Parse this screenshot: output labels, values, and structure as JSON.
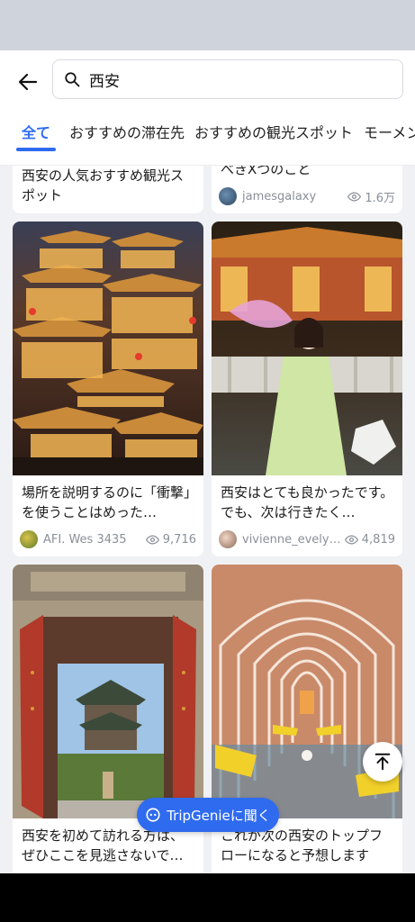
{
  "search": {
    "query": "西安"
  },
  "tabs": [
    {
      "label": "全て",
      "active": true
    },
    {
      "label": "おすすめの滞在先",
      "active": false
    },
    {
      "label": "おすすめの観光スポット",
      "active": false
    },
    {
      "label": "モーメン",
      "active": false
    }
  ],
  "cards": [
    {
      "title": "西安の人気おすすめ観光スポット",
      "author": "",
      "views": ""
    },
    {
      "title": "べきXつのこと",
      "author": "jamesgalaxy",
      "views": "1.6万"
    },
    {
      "title": "場所を説明するのに「衝撃」を使うことはめった…",
      "author": "AFI. Wes 3435",
      "views": "9,716"
    },
    {
      "title": "西安はとても良かったです。でも、次は行きたく…",
      "author": "vivienne_evelyn…",
      "views": "4,819"
    },
    {
      "title": "西安を初めて訪れる方は、ぜひここを見逃さないで…",
      "author": "",
      "views": ""
    },
    {
      "title": "これが次の西安のトップフローになると予想します",
      "author": "",
      "views": ""
    }
  ],
  "floating": {
    "tripgenie_label": "TripGenieに聞く"
  },
  "icons": {
    "back": "arrow-left-icon",
    "search": "search-icon",
    "views": "eye-icon",
    "scroll_top": "arrow-up-to-top-icon",
    "tripgenie": "tripgenie-chat-icon"
  },
  "colors": {
    "accent": "#2f6bef",
    "meta_text": "#8a8f99",
    "background": "#f0f1f4"
  }
}
